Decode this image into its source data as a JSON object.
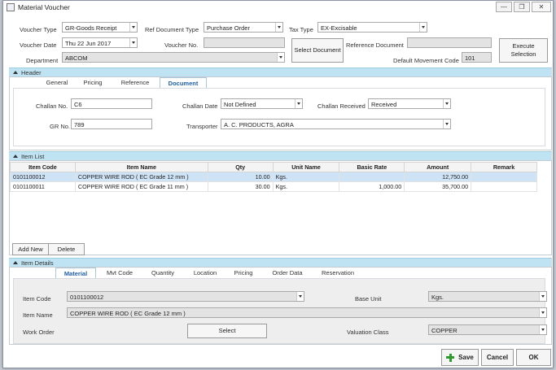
{
  "window": {
    "title": "Material Voucher",
    "min": "—",
    "max": "❐",
    "close": "✕"
  },
  "top": {
    "voucher_type_label": "Voucher Type",
    "voucher_type": "GR-Goods Receipt",
    "ref_doc_type_label": "Ref Document Type",
    "ref_doc_type": "Purchase Order",
    "tax_type_label": "Tax Type",
    "tax_type": "EX-Excisable",
    "voucher_date_label": "Voucher Date",
    "voucher_date": "Thu 22 Jun 2017",
    "voucher_no_label": "Voucher No.",
    "voucher_no": "",
    "select_document": "Select Document",
    "reference_document_label": "Reference Document",
    "reference_document": "",
    "execute_selection": "Execute Selection",
    "department_label": "Department",
    "department": "ABCOM",
    "default_movement_code_label": "Default Movement Code",
    "default_movement_code": "101"
  },
  "header": {
    "title": "Header",
    "tabs": [
      "General",
      "Pricing",
      "Reference",
      "Document"
    ],
    "challan_no_label": "Challan No.",
    "challan_no": "C6",
    "challan_date_label": "Challan Date",
    "challan_date": "Not Defined",
    "challan_received_label": "Challan Received",
    "challan_received": "Received",
    "gr_no_label": "GR No.",
    "gr_no": "789",
    "transporter_label": "Transporter",
    "transporter": "A. C. PRODUCTS, AGRA"
  },
  "item_list": {
    "title": "Item List",
    "columns": [
      "Item Code",
      "Item Name",
      "Qty",
      "Unit Name",
      "Basic Rate",
      "Amount",
      "Remark"
    ],
    "rows": [
      {
        "code": "0101100012",
        "name": "COPPER WIRE ROD ( EC Grade 12 mm )",
        "qty": "10.00",
        "unit": "Kgs.",
        "rate": "",
        "amount": "12,750.00",
        "remark": ""
      },
      {
        "code": "0101100011",
        "name": "COPPER WIRE ROD ( EC Grade 11 mm )",
        "qty": "30.00",
        "unit": "Kgs.",
        "rate": "1,000.00",
        "amount": "35,700.00",
        "remark": ""
      }
    ],
    "add_new": "Add New",
    "delete": "Delete"
  },
  "item_details": {
    "title": "Item Details",
    "tabs": [
      "Material",
      "Mvt Code",
      "Quantity",
      "Location",
      "Pricing",
      "Order Data",
      "Reservation"
    ],
    "item_code_label": "Item Code",
    "item_code": "0101100012",
    "base_unit_label": "Base Unit",
    "base_unit": "Kgs.",
    "item_name_label": "Item Name",
    "item_name": "COPPER WIRE ROD ( EC Grade 12 mm )",
    "work_order_label": "Work Order",
    "select": "Select",
    "valuation_class_label": "Valuation Class",
    "valuation_class": "COPPER"
  },
  "footer": {
    "save": "Save",
    "cancel": "Cancel",
    "ok": "OK"
  }
}
